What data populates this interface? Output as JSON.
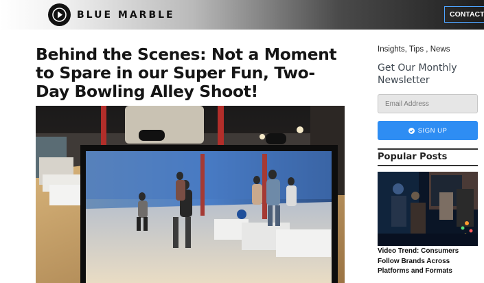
{
  "header": {
    "brand_name": "BLUE MARBLE",
    "logo_icon": "play-icon",
    "contact_label": "CONTACT US"
  },
  "article": {
    "title": "Behind the Scenes: Not a Moment to Spare in our Super Fun, Two-Day Bowling Alley Shoot!",
    "hero_image": "bowling-alley-monitor-photo"
  },
  "sidebar": {
    "categories": "Insights, Tips , News",
    "newsletter_title": "Get Our Monthly Newsletter",
    "email_placeholder": "Email Address",
    "signup_label": "SIGN UP",
    "popular_title": "Popular Posts",
    "popular_posts": [
      {
        "title": "Video Trend: Consumers Follow Brands Across Platforms and Formats",
        "thumb": "concert-crowd-photo"
      }
    ]
  },
  "colors": {
    "accent": "#2e8df3",
    "contact_border": "#4da3ff",
    "heading": "#151515",
    "newsletter_heading": "#3e4750"
  }
}
